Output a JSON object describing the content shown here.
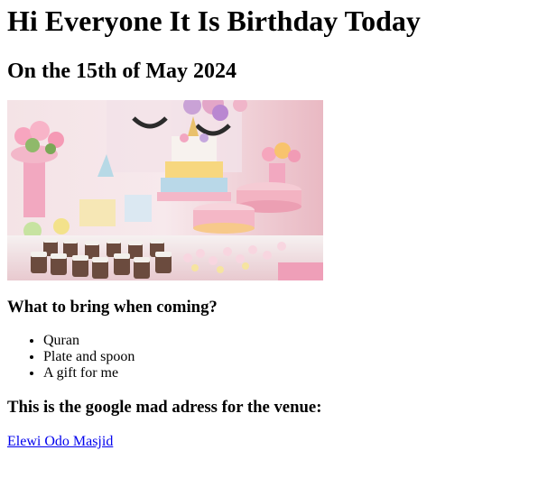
{
  "heading": "Hi Everyone It Is Birthday Today",
  "subheading": "On the 15th of May 2024",
  "bring_title": "What to bring when coming?",
  "bring_items": [
    "Quran",
    "Plate and spoon",
    "A gift for me"
  ],
  "venue_title": "This is the google mad adress for the venue:",
  "venue_link": "Elewi Odo Masjid",
  "colors": {
    "link": "#0000ee",
    "text": "#000000"
  }
}
